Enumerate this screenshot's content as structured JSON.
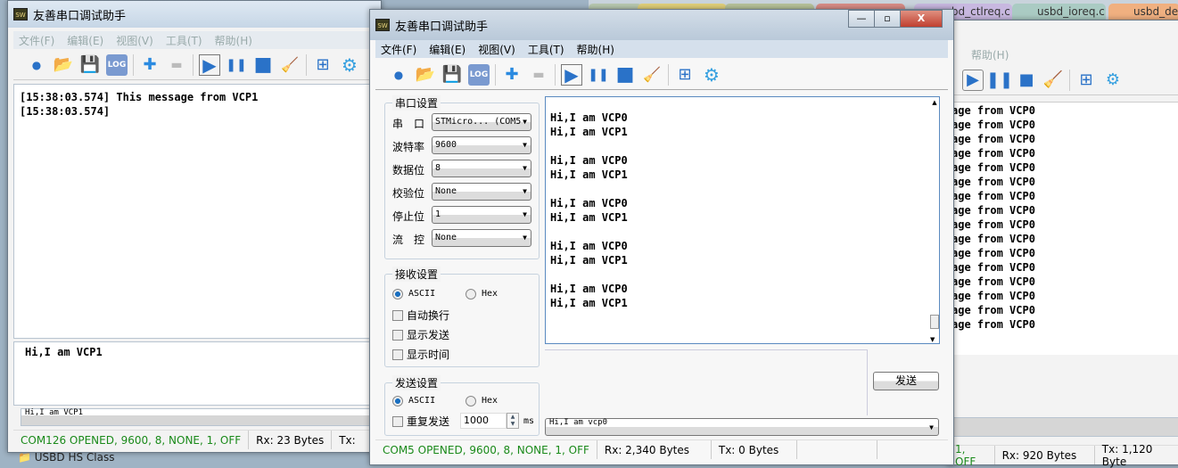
{
  "background_tabs": [
    "usbd_ctlreq.c",
    "usbd_ioreq.c",
    "usbd_def.h"
  ],
  "tree_item": "USBD HS Class",
  "app_title": "友善串口调试助手",
  "menu": [
    "文件(F)",
    "编辑(E)",
    "视图(V)",
    "工具(T)",
    "帮助(H)"
  ],
  "toolbar_icons": [
    "new-icon",
    "open-folder-icon",
    "save-icon",
    "log-icon",
    "add-icon",
    "remove-icon",
    "play-icon",
    "pause-icon",
    "stop-icon",
    "broom-icon",
    "add-window-icon",
    "gear-icon"
  ],
  "left_window": {
    "receive_lines": [
      "[15:38:03.574] This message from VCP1",
      "[15:38:03.574]"
    ],
    "send_text": "Hi,I am VCP1",
    "send_combo": "Hi,I am VCP1",
    "status": {
      "port": "COM126 OPENED, 9600, 8, NONE, 1, OFF",
      "rx": "Rx: 23 Bytes",
      "tx": "Tx:"
    }
  },
  "middle_window": {
    "controls": {
      "minimize": "—",
      "maximize": "▫",
      "close": "X"
    },
    "serial_settings": {
      "title": "串口设置",
      "fields": [
        {
          "label": "串　口",
          "value": "STMicro... (COM5"
        },
        {
          "label": "波特率",
          "value": "9600"
        },
        {
          "label": "数据位",
          "value": "8"
        },
        {
          "label": "校验位",
          "value": "None"
        },
        {
          "label": "停止位",
          "value": "1"
        },
        {
          "label": "流　控",
          "value": "None"
        }
      ]
    },
    "receive_settings": {
      "title": "接收设置",
      "ascii": "ASCII",
      "hex": "Hex",
      "mode": "ASCII",
      "checks": [
        {
          "label": "自动换行",
          "checked": false
        },
        {
          "label": "显示发送",
          "checked": false
        },
        {
          "label": "显示时间",
          "checked": false
        }
      ]
    },
    "send_settings": {
      "title": "发送设置",
      "ascii": "ASCII",
      "hex": "Hex",
      "mode": "ASCII",
      "repeat_label": "重复发送",
      "repeat_checked": false,
      "interval": "1000",
      "unit": "ms"
    },
    "receive_lines": [
      "Hi,I am VCP0",
      "Hi,I am VCP1",
      "",
      "Hi,I am VCP0",
      "Hi,I am VCP1",
      "",
      "Hi,I am VCP0",
      "Hi,I am VCP1",
      "",
      "Hi,I am VCP0",
      "Hi,I am VCP1",
      "",
      "Hi,I am VCP0",
      "Hi,I am VCP1"
    ],
    "send_button": "发送",
    "send_combo": "Hi,I am vcp0",
    "status": {
      "port": "COM5 OPENED, 9600, 8, NONE, 1, OFF",
      "rx": "Rx: 2,340 Bytes",
      "tx": "Tx: 0 Bytes"
    }
  },
  "right_window": {
    "menu_help": "帮助(H)",
    "receive_lines": [
      "age from VCP0",
      "age from VCP0",
      "age from VCP0",
      "age from VCP0",
      "age from VCP0",
      "age from VCP0",
      "age from VCP0",
      "age from VCP0",
      "age from VCP0",
      "age from VCP0",
      "age from VCP0",
      "age from VCP0",
      "age from VCP0",
      "age from VCP0",
      "age from VCP0",
      "age from VCP0"
    ],
    "status": {
      "port": "1, OFF",
      "rx": "Rx: 920 Bytes",
      "tx": "Tx: 1,120 Byte"
    }
  },
  "colors": {
    "status_green": "#1a8a1a",
    "accent_blue": "#2a72c8"
  }
}
